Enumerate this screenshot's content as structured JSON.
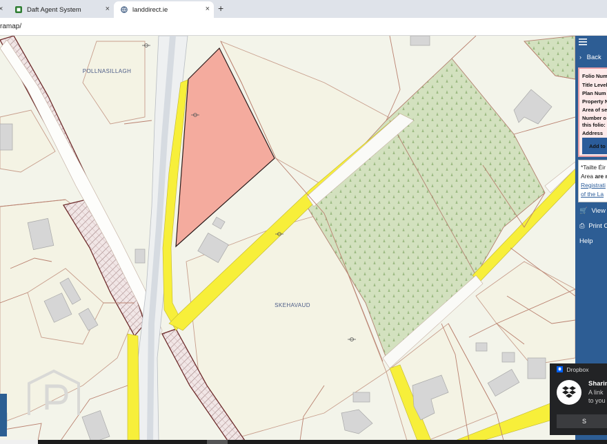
{
  "browser": {
    "tabs": [
      {
        "label": "Daft Agent System",
        "active": false
      },
      {
        "label": "landdirect.ie",
        "active": true
      }
    ],
    "new_tab_symbol": "+",
    "close_symbol": "×",
    "address": "ramap/"
  },
  "map": {
    "townlands": [
      "POLLNASILLAGH",
      "SKEHAVAUD"
    ],
    "colors": {
      "background": "#f3f4ea",
      "parcel_border": "#b9806f",
      "selected_parcel": "#f4ab9e",
      "road_yellow": "#f7ef3a",
      "forest": "#d2e0bd",
      "building": "#d5d5d5",
      "hatched_road": "#e3b9b9"
    }
  },
  "sidebar": {
    "menu_icon": "hamburger-icon",
    "back_label": "Back",
    "info_rows": [
      "Folio Num",
      "Title Level",
      "Plan Num",
      "Property N",
      "Area of se",
      "Number o",
      "this folio:",
      "Address"
    ],
    "add_button": "Add to",
    "note_lines": [
      "*Tailte Éir",
      "Area",
      "are n",
      "Registrati",
      "of the La"
    ],
    "view_label": "View E",
    "print_label": "Print C",
    "help_label": "Help"
  },
  "dropbox": {
    "header": "Dropbox",
    "title": "Sharin",
    "line1": "A link",
    "line2": "to you",
    "button": "S"
  }
}
